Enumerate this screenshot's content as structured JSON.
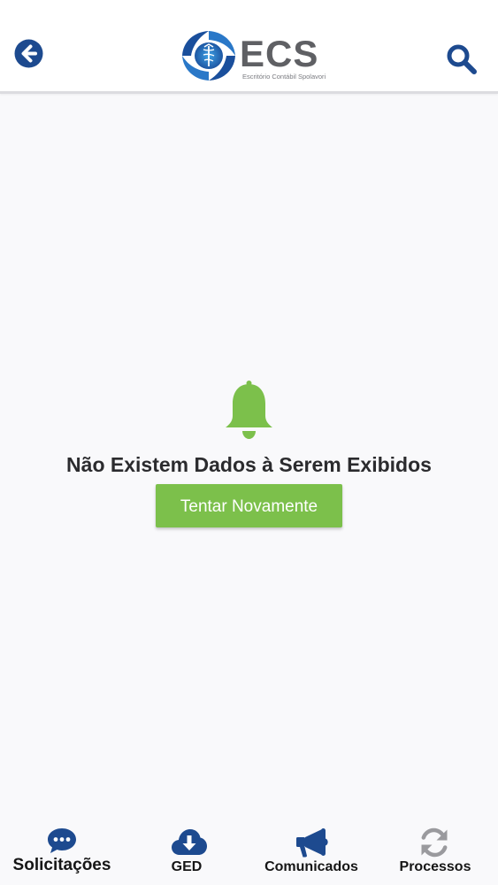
{
  "header": {
    "logo": {
      "text": "ECS",
      "subtitle": "Escritório Contábil Spolavori"
    },
    "back_icon": "arrow-left-circle-icon",
    "search_icon": "search-icon"
  },
  "empty_state": {
    "icon": "bell-icon",
    "message": "Não Existem Dados à Serem Exibidos",
    "retry_label": "Tentar Novamente"
  },
  "tabbar": {
    "tabs": [
      {
        "label": "Solicitações",
        "icon": "chat-bubble-icon",
        "active": true
      },
      {
        "label": "GED",
        "icon": "cloud-download-icon",
        "active": false
      },
      {
        "label": "Comunicados",
        "icon": "megaphone-icon",
        "active": false
      },
      {
        "label": "Processos",
        "icon": "sync-icon",
        "active": false
      }
    ]
  },
  "colors": {
    "primary_blue": "#1d4a8f",
    "accent_green": "#7cc04b",
    "inactive_gray": "#9a9a9e",
    "logo_gray": "#5f6064",
    "background": "#f9f9fb"
  }
}
